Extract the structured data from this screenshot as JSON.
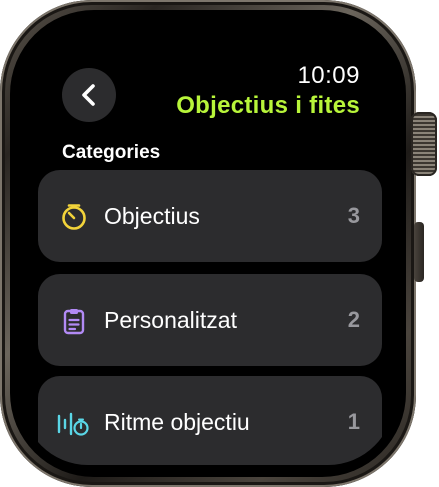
{
  "status": {
    "time": "10:09"
  },
  "header": {
    "title": "Objectius i fites",
    "title_color": "#b8f53a",
    "back_icon": "chevron-left-icon"
  },
  "categories": {
    "label": "Categories",
    "items": [
      {
        "label": "Objectius",
        "count": "3",
        "icon": "timer-icon",
        "icon_color": "#f2d33a"
      },
      {
        "label": "Personalitzat",
        "count": "2",
        "icon": "clipboard-icon",
        "icon_color": "#b28af5"
      },
      {
        "label": "Ritme objectiu",
        "count": "1",
        "icon": "pace-icon",
        "icon_color": "#5ad6e6"
      }
    ]
  }
}
